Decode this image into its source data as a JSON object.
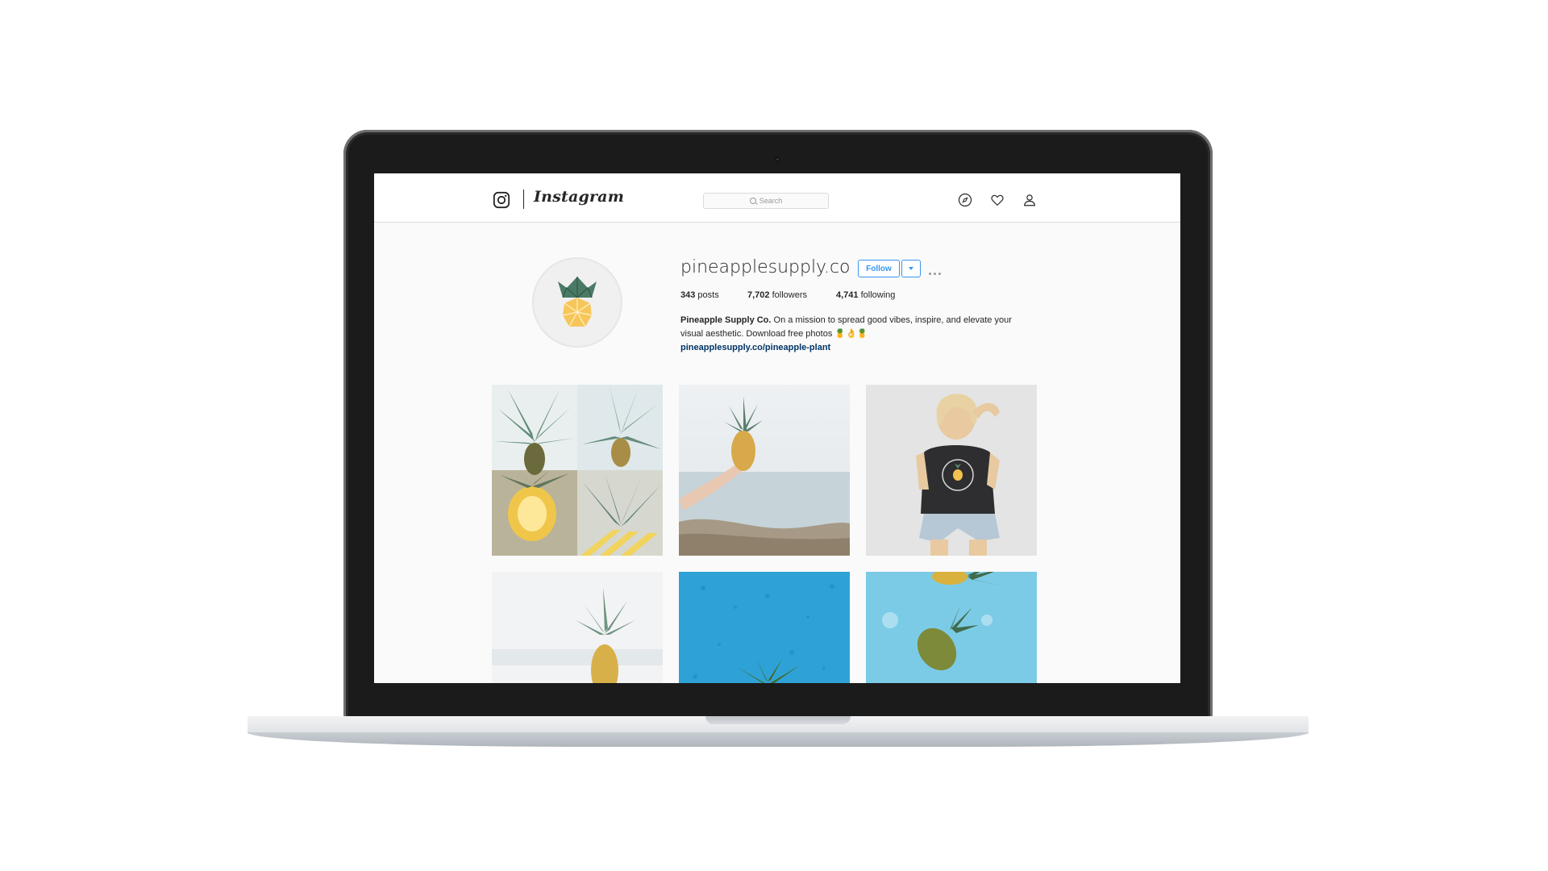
{
  "header": {
    "logo_text": "Instagram",
    "search_placeholder": "Search"
  },
  "icons": {
    "camera": "instagram-camera-icon",
    "explore": "compass-icon",
    "activity": "heart-icon",
    "profile": "person-icon"
  },
  "profile": {
    "username": "pineapplesupply.co",
    "follow_label": "Follow",
    "posts_count": "343",
    "posts_label": "posts",
    "followers_count": "7,702",
    "followers_label": "followers",
    "following_count": "4,741",
    "following_label": "following",
    "bio_name": "Pineapple Supply Co.",
    "bio_text": "On a mission to spread good vibes, inspire, and elevate your visual aesthetic. Download free photos 🍍👌🍍",
    "bio_link": "pineapplesupply.co/pineapple-plant"
  },
  "colors": {
    "link_blue": "#3897f0",
    "text": "#262626",
    "bio_link": "#003569"
  }
}
